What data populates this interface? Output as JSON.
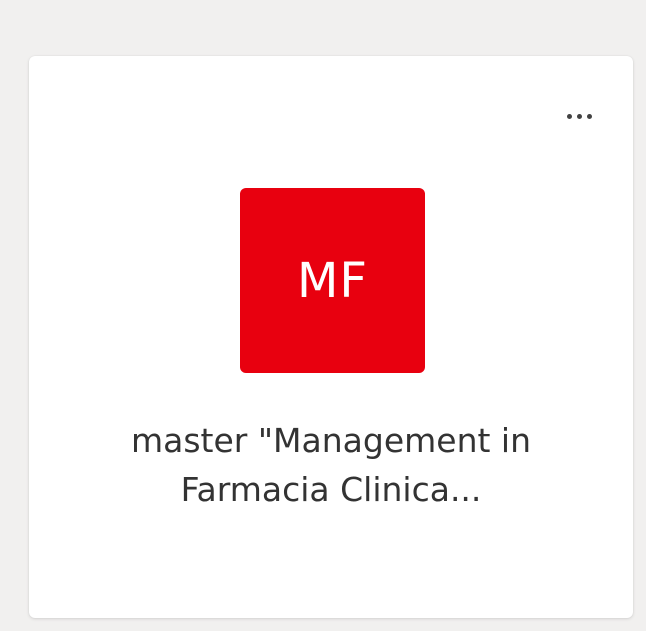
{
  "card": {
    "avatar_initials": "MF",
    "avatar_color": "#e8000f",
    "name_line1": "master \"Management in",
    "name_line2": "Farmacia Clinica...",
    "more_icon": "more-horizontal-icon"
  }
}
